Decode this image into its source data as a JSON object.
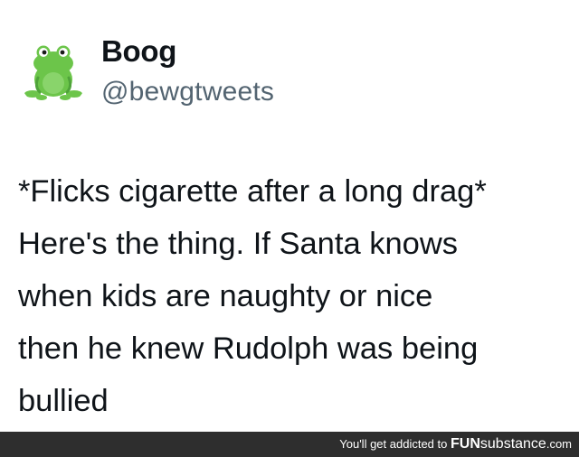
{
  "tweet": {
    "display_name": "Boog",
    "handle": "@bewgtweets",
    "text_lines": [
      "*Flicks cigarette after a long drag*",
      "Here's the thing. If Santa knows",
      "when kids are naughty or nice",
      "then he knew Rudolph was being",
      "bullied"
    ]
  },
  "avatar": {
    "icon": "frog-icon",
    "color": "#6cc54a"
  },
  "footer": {
    "tagline": "You'll get addicted to",
    "brand_bold": "FUN",
    "brand_rest": "substance",
    "brand_tld": ".com",
    "background": "#2e2e2e"
  }
}
